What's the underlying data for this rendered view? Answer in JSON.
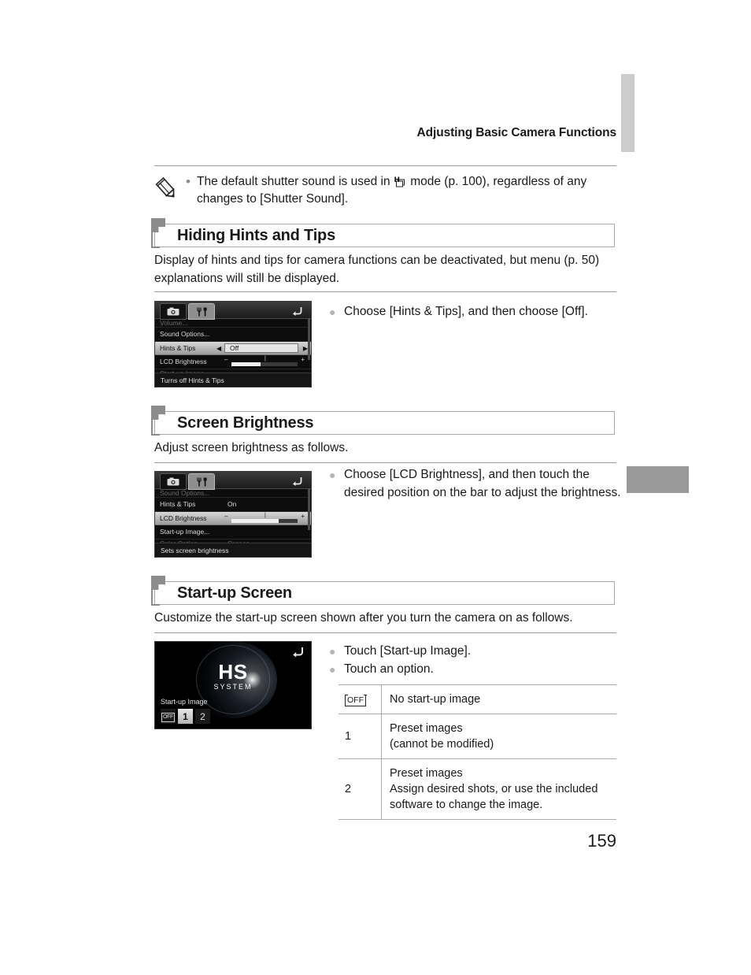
{
  "page": {
    "running_header": "Adjusting Basic Camera Functions",
    "page_number": "159"
  },
  "note": {
    "icon": "pencil-icon",
    "bullet": "•",
    "text_before": "The default shutter sound is used in",
    "mode_icon": "high-speed-burst-icon",
    "text_after": "mode (p. 100), regardless of any changes to [Shutter Sound]."
  },
  "sections": [
    {
      "heading": "Hiding Hints and Tips",
      "description": "Display of hints and tips for camera functions can be deactivated, but menu (p. 50) explanations will still be displayed.",
      "instructions": [
        "Choose [Hints & Tips], and then choose [Off]."
      ],
      "screen": {
        "tabs": {
          "shoot": "camera-icon",
          "setup": "wrench-fork-icon"
        },
        "back": "return-arrow-icon",
        "rows": [
          {
            "label": "Volume...",
            "value": "",
            "state": "clipped-top"
          },
          {
            "label": "Sound Options...",
            "value": "",
            "state": "normal"
          },
          {
            "label": "Hints & Tips",
            "value": "Off",
            "state": "selected"
          },
          {
            "label": "LCD Brightness",
            "value": "slider",
            "state": "normal"
          },
          {
            "label": "Start-up Image...",
            "value": "",
            "state": "clipped-bottom"
          }
        ],
        "slider": {
          "minus": "–",
          "plus": "+",
          "fill_percent": 44
        },
        "hint": "Turns off Hints & Tips"
      }
    },
    {
      "heading": "Screen Brightness",
      "description": "Adjust screen brightness as follows.",
      "instructions": [
        "Choose [LCD Brightness], and then touch the desired position on the bar to adjust the brightness."
      ],
      "screen": {
        "tabs": {
          "shoot": "camera-icon",
          "setup": "wrench-fork-icon"
        },
        "back": "return-arrow-icon",
        "rows": [
          {
            "label": "Sound Options...",
            "value": "",
            "state": "clipped-top"
          },
          {
            "label": "Hints & Tips",
            "value": "On",
            "state": "normal"
          },
          {
            "label": "LCD Brightness",
            "value": "slider",
            "state": "selected"
          },
          {
            "label": "Start-up Image...",
            "value": "",
            "state": "normal"
          },
          {
            "label": "Color Option",
            "value": "Orange",
            "state": "clipped-bottom"
          }
        ],
        "slider": {
          "minus": "–",
          "plus": "+",
          "fill_percent": 72
        },
        "hint": "Sets screen brightness"
      }
    },
    {
      "heading": "Start-up Screen",
      "description": "Customize the start-up screen shown after you turn the camera on as follows.",
      "instructions": [
        "Touch [Start-up Image].",
        "Touch an option."
      ],
      "splash": {
        "logo_main": "HS",
        "logo_sub": "SYSTEM",
        "back": "return-arrow-icon",
        "label": "Start-up Image",
        "options": [
          {
            "text": "OFF",
            "type": "off-glyph",
            "selected": false
          },
          {
            "text": "1",
            "type": "number",
            "selected": true
          },
          {
            "text": "2",
            "type": "number",
            "selected": false
          }
        ]
      },
      "option_table": {
        "rows": [
          {
            "key": "OFF",
            "key_type": "off-glyph",
            "desc": "No start-up image"
          },
          {
            "key": "1",
            "key_type": "number",
            "desc": "Preset images\n(cannot be modified)"
          },
          {
            "key": "2",
            "key_type": "number",
            "desc": "Preset images\nAssign desired shots, or use the included\nsoftware to change the image."
          }
        ]
      }
    }
  ]
}
